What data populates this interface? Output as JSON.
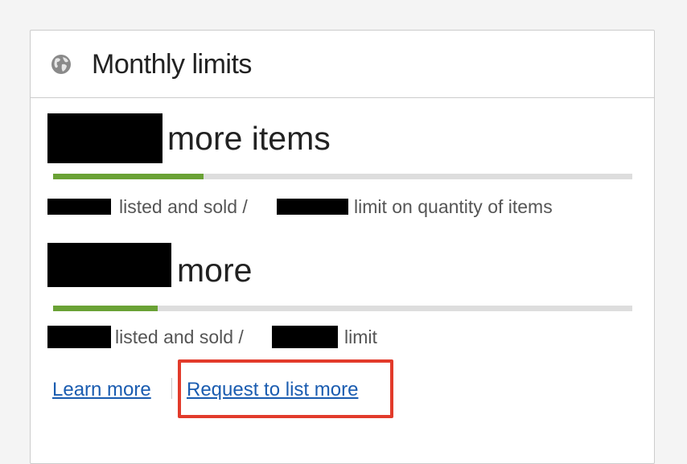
{
  "card": {
    "title": "Monthly limits",
    "icon": "globe-icon"
  },
  "items_limit": {
    "remaining_suffix": "more items",
    "progress_fraction": 0.26,
    "usage_text": "listed and sold /",
    "limit_text": "limit on quantity of items"
  },
  "amount_limit": {
    "remaining_suffix": "more",
    "progress_fraction": 0.18,
    "usage_text": "listed and sold /",
    "limit_text": "limit"
  },
  "links": {
    "learn_more": "Learn more",
    "request_more": "Request to list more"
  },
  "colors": {
    "progress_fill": "#6aa235",
    "progress_track": "#dddddd",
    "link": "#1a5cb0",
    "highlight_border": "#e23b2b"
  }
}
